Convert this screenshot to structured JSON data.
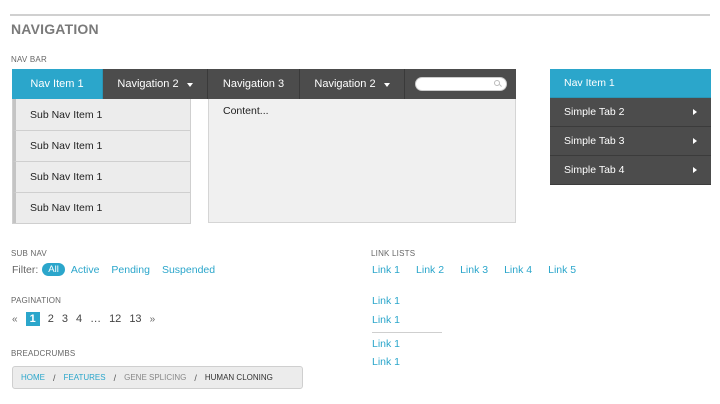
{
  "section_title": "NAVIGATION",
  "nav_bar": {
    "caption": "NAV BAR",
    "items": [
      {
        "label": "Nav Item 1"
      },
      {
        "label": "Navigation 2"
      },
      {
        "label": "Navigation 3"
      },
      {
        "label": "Navigation 2"
      }
    ],
    "search": {
      "value": "",
      "placeholder": ""
    },
    "dropdown_items": [
      "Sub Nav Item 1",
      "Sub Nav Item 1",
      "Sub Nav Item 1",
      "Sub Nav Item 1"
    ],
    "content": "Content..."
  },
  "side_tabs": [
    "Nav Item 1",
    "Simple Tab 2",
    "Simple Tab 3",
    "Simple Tab 4"
  ],
  "sub_nav": {
    "caption": "SUB NAV",
    "filter_label": "Filter:",
    "options": [
      "All",
      "Active",
      "Pending",
      "Suspended"
    ]
  },
  "pagination": {
    "caption": "PAGINATION",
    "prev": "«",
    "pages": [
      "1",
      "2",
      "3",
      "4",
      "…",
      "12",
      "13"
    ],
    "next": "»",
    "current": "1"
  },
  "breadcrumbs": {
    "caption": "BREADCRUMBS",
    "items": [
      "HOME",
      "FEATURES",
      "GENE SPLICING",
      "HUMAN CLONING"
    ],
    "separator": "/"
  },
  "link_lists": {
    "caption": "LINK LISTS",
    "inline": [
      "Link 1",
      "Link 2",
      "Link 3",
      "Link 4",
      "Link 5"
    ],
    "vertical_top": [
      "Link 1",
      "Link 1"
    ],
    "vertical_bottom": [
      "Link 1",
      "Link 1"
    ]
  },
  "colors": {
    "accent": "#2ba6cb",
    "bar": "#4c4c4c"
  }
}
